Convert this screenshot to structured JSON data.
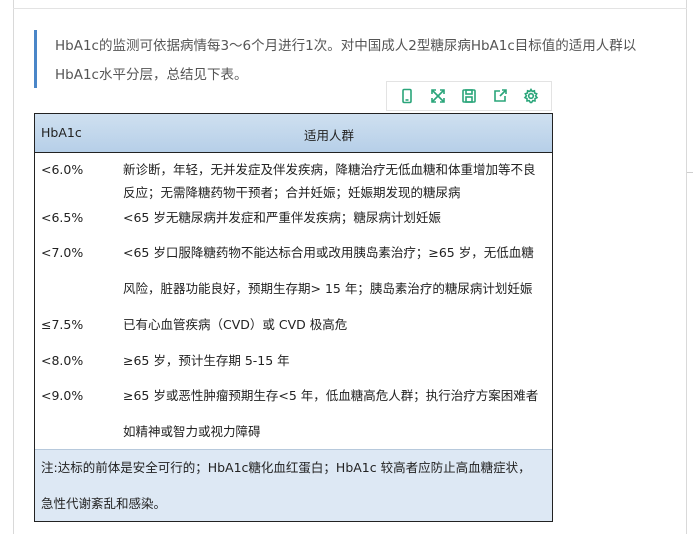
{
  "intro": {
    "text": "HbA1c的监测可依据病情每3～6个月进行1次。对中国成人2型糖尿病HbA1c目标值的适用人群以HbA1c水平分层，总结见下表。"
  },
  "toolbar": {
    "icons": [
      "phone-icon",
      "expand-icon",
      "save-icon",
      "share-icon",
      "settings-icon"
    ]
  },
  "table": {
    "headers": [
      "HbA1c",
      "适用人群"
    ],
    "rows": [
      {
        "level": "<6.0%",
        "lines": [
          "新诊断，年轻，无并发症及伴发疾病，降糖治疗无低血糖和体重增加等不良",
          "反应；无需降糖药物干预者；合并妊娠；妊娠期发现的糖尿病"
        ]
      },
      {
        "level": "<6.5%",
        "lines": [
          "<65 岁无糖尿病并发症和严重伴发疾病；糖尿病计划妊娠"
        ]
      },
      {
        "level": "<7.0%",
        "lines": [
          "<65 岁口服降糖药物不能达标合用或改用胰岛素治疗；≥65 岁，无低血糖",
          "风险，脏器功能良好，预期生存期> 15 年；胰岛素治疗的糖尿病计划妊娠"
        ]
      },
      {
        "level": "≤7.5%",
        "lines": [
          "已有心血管疾病（CVD）或 CVD 极高危"
        ]
      },
      {
        "level": "<8.0%",
        "lines": [
          "≥65 岁，预计生存期 5-15 年"
        ]
      },
      {
        "level": "<9.0%",
        "lines": [
          "≥65 岁或恶性肿瘤预期生存<5 年，低血糖高危人群；执行治疗方案困难者",
          "如精神或智力或视力障碍"
        ]
      }
    ],
    "note_lines": [
      "注:达标的前体是安全可行的；HbA1c糖化血红蛋白；HbA1c 较高者应防止高血糖症状，",
      "急性代谢紊乱和感染。"
    ]
  }
}
